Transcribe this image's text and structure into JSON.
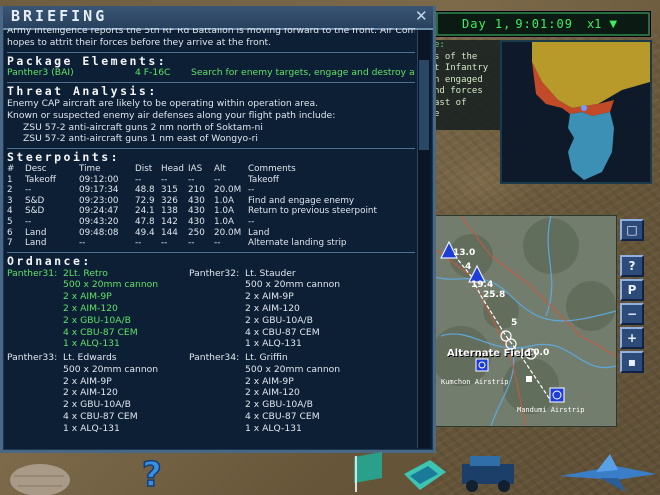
{
  "clock": {
    "day": "Day 1,",
    "time": "9:01:09",
    "speed": "x1",
    "dropdown_icon": "triangle-down-icon"
  },
  "side_panel": {
    "heading": "e:",
    "lines": [
      "s of the",
      "t Infantry",
      "n engaged",
      "nd forces",
      "ast of",
      "e"
    ]
  },
  "briefing": {
    "title": "BRIEFING",
    "intro_lines": [
      "Army Intelligence reports the 5th RF Rd Battalion is moving forward to the front. Air Command",
      "hopes to attrit their forces before they arrive at the front."
    ],
    "package": {
      "heading": "Package Elements:",
      "flight": "Panther3 (BAI)",
      "aircraft": "4 F-16C",
      "task": "Search for enemy targets, engage and destroy at will"
    },
    "threat": {
      "heading": "Threat Analysis:",
      "lines": [
        "Enemy CAP aircraft are likely to be operating within operation area.",
        "Known or suspected enemy air defenses along your flight path include:"
      ],
      "items": [
        "ZSU 57-2 anti-aircraft guns 2 nm north of Soktam-ni",
        "ZSU 57-2 anti-aircraft guns 1 nm east of Wongyo-ri"
      ]
    },
    "steerpoints": {
      "heading": "Steerpoints:",
      "columns": [
        "#",
        "Desc",
        "Time",
        "Dist",
        "Head",
        "IAS",
        "Alt",
        "Comments"
      ],
      "rows": [
        [
          "1",
          "Takeoff",
          "09:12:00",
          "--",
          "--",
          "--",
          "--",
          "Takeoff"
        ],
        [
          "2",
          "--",
          "09:17:34",
          "48.8",
          "315",
          "210",
          "20.0M",
          "--"
        ],
        [
          "3",
          "S&D",
          "09:23:00",
          "72.9",
          "326",
          "430",
          "1.0A",
          "Find and engage enemy"
        ],
        [
          "4",
          "S&D",
          "09:24:47",
          "24.1",
          "138",
          "430",
          "1.0A",
          "Return to previous steerpoint"
        ],
        [
          "5",
          "--",
          "09:43:20",
          "47.8",
          "142",
          "430",
          "1.0A",
          "--"
        ],
        [
          "6",
          "Land",
          "09:48:08",
          "49.4",
          "144",
          "250",
          "20.0M",
          "Land"
        ],
        [
          "7",
          "Land",
          "--",
          "--",
          "--",
          "--",
          "--",
          "Alternate landing strip"
        ]
      ]
    },
    "ordnance": {
      "heading": "Ordnance:",
      "pilots": [
        {
          "callsign": "Panther31:",
          "name": "2Lt. Retro",
          "stores": [
            "500 x 20mm cannon",
            "2 x AIM-9P",
            "2 x AIM-120",
            "2 x GBU-10A/B",
            "4 x CBU-87 CEM",
            "1 x ALQ-131"
          ],
          "highlight": true
        },
        {
          "callsign": "Panther32:",
          "name": "Lt. Stauder",
          "stores": [
            "500 x 20mm cannon",
            "2 x AIM-9P",
            "2 x AIM-120",
            "2 x GBU-10A/B",
            "4 x CBU-87 CEM",
            "1 x ALQ-131"
          ],
          "highlight": false
        },
        {
          "callsign": "Panther33:",
          "name": "Lt. Edwards",
          "stores": [
            "500 x 20mm cannon",
            "2 x AIM-9P",
            "2 x AIM-120",
            "2 x GBU-10A/B",
            "4 x CBU-87 CEM",
            "1 x ALQ-131"
          ],
          "highlight": false
        },
        {
          "callsign": "Panther34:",
          "name": "Lt. Griffin",
          "stores": [
            "500 x 20mm cannon",
            "2 x AIM-9P",
            "2 x AIM-120",
            "2 x GBU-10A/B",
            "4 x CBU-87 CEM",
            "1 x ALQ-131"
          ],
          "highlight": false
        }
      ]
    }
  },
  "tactical_map": {
    "labels": {
      "alt_field": "Alternate Field",
      "kumchon": "Kumchon Airstrip",
      "mandumi": "Mandumi Airstrip",
      "wp_a": "13.0",
      "wp_b": "4",
      "wp_c": "19.4",
      "wp_d": "25.8",
      "wp_e": "5",
      "wp_f": "20.0"
    }
  },
  "right_buttons": [
    "square-icon",
    "?",
    "P",
    "−",
    "+",
    "square-small-icon"
  ],
  "colors": {
    "panel_bg": "#0d1f34",
    "green_text": "#5fe068",
    "title_bar": "#3a5675"
  }
}
